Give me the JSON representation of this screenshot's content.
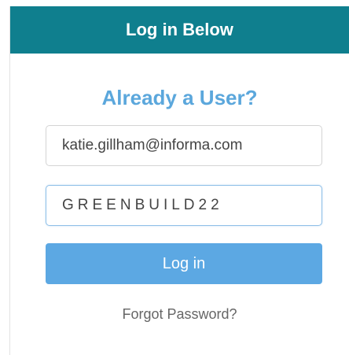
{
  "header": {
    "title": "Log in Below"
  },
  "form": {
    "subtitle": "Already a User?",
    "email_value": "katie.gillham@informa.com",
    "password_value": "GREENBUILD22",
    "login_label": "Log in",
    "forgot_label": "Forgot Password?"
  },
  "colors": {
    "header_bg": "#0f7f8e",
    "accent": "#5ba7dc",
    "button_bg": "#5ca8e3"
  }
}
